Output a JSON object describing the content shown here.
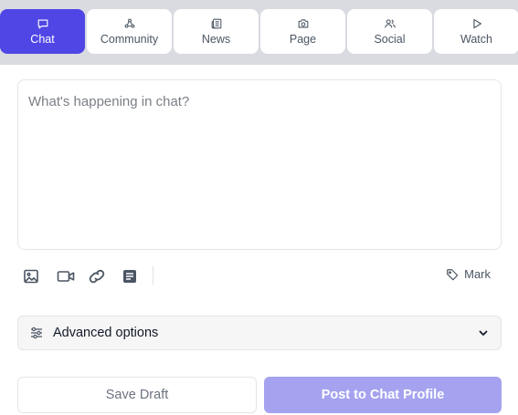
{
  "tabs": [
    {
      "label": "Chat",
      "icon": "chat-icon",
      "active": true
    },
    {
      "label": "Community",
      "icon": "community-icon",
      "active": false
    },
    {
      "label": "News",
      "icon": "news-icon",
      "active": false
    },
    {
      "label": "Page",
      "icon": "camera-icon",
      "active": false
    },
    {
      "label": "Social",
      "icon": "users-icon",
      "active": false
    },
    {
      "label": "Watch",
      "icon": "play-icon",
      "active": false
    }
  ],
  "composer": {
    "placeholder": "What's happening in chat?",
    "value": ""
  },
  "toolbar": {
    "tools": [
      "image-icon",
      "video-icon",
      "link-icon",
      "note-icon"
    ],
    "mark_label": "Mark",
    "mark_icon": "tag-icon"
  },
  "advanced": {
    "label": "Advanced options",
    "icon": "sliders-icon",
    "chevron": "chevron-down-icon",
    "expanded": false
  },
  "actions": {
    "save_draft_label": "Save Draft",
    "post_label": "Post to Chat Profile"
  },
  "colors": {
    "accent": "#4f46e5",
    "accent_disabled": "#a5a3ef",
    "tabbar_bg": "#d9dbe1"
  }
}
